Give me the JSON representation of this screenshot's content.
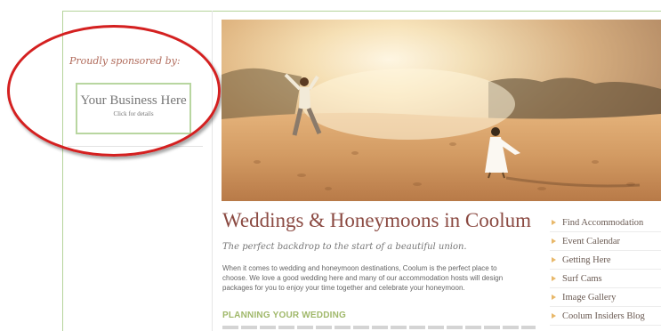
{
  "sidebar": {
    "sponsor_label": "Proudly sponsored by:",
    "ad": {
      "title": "Your Business Here",
      "subtitle": "Click for details"
    }
  },
  "main": {
    "hero_image": "beach-wedding-couple-photo",
    "title": "Weddings & Honeymoons in Coolum",
    "tagline": "The perfect backdrop to the start of a beautiful union.",
    "intro_lines": [
      "When it comes to wedding and honeymoon destinations, Coolum is the perfect place to",
      "choose. We love a good wedding here and many of our accommodation hosts will design",
      "packages for you to enjoy your time together and celebrate your honeymoon."
    ],
    "section_heading": "PLANNING YOUR WEDDING"
  },
  "nav": {
    "items": [
      {
        "label": "Find Accommodation"
      },
      {
        "label": "Event Calendar"
      },
      {
        "label": "Getting Here"
      },
      {
        "label": "Surf Cams"
      },
      {
        "label": "Image Gallery"
      },
      {
        "label": "Coolum Insiders Blog"
      }
    ]
  },
  "colors": {
    "frame_border": "#b5d39a",
    "highlight_oval": "#d42020",
    "title": "#8b4a42",
    "section_heading": "#a0b86a",
    "nav_arrow": "#e8b86a"
  }
}
